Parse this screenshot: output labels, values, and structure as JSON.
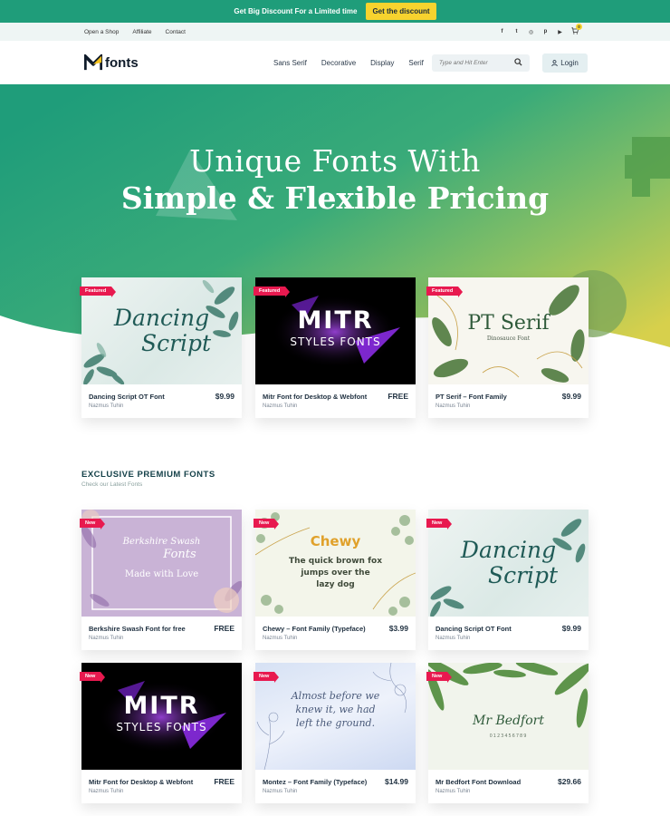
{
  "promo": {
    "text": "Get Big Discount For a Limited time",
    "button": "Get the discount"
  },
  "util": {
    "links": [
      "Open a Shop",
      "Affiliate",
      "Contact"
    ],
    "social": [
      "f",
      "t",
      "◎",
      "p",
      "▶"
    ],
    "cart_count": "0"
  },
  "nav": {
    "logo": "fonts",
    "menu": [
      "Sans Serif",
      "Decorative",
      "Display",
      "Serif"
    ],
    "search_placeholder": "Type and Hit Enter",
    "login": "Login"
  },
  "hero": {
    "line1": "Unique Fonts With",
    "line2": "Simple & Flexible Pricing"
  },
  "featured": [
    {
      "badge": "Featured",
      "name": "Dancing Script OT Font",
      "author": "Nazmus Tuhin",
      "price": "$9.99",
      "art": [
        "Dancing",
        "Script"
      ]
    },
    {
      "badge": "Featured",
      "name": "Mitr Font for Desktop & Webfont",
      "author": "Nazmus Tuhin",
      "price": "FREE",
      "art": [
        "MITR",
        "STYLES FONTS"
      ]
    },
    {
      "badge": "Featured",
      "name": "PT Serif – Font Family",
      "author": "Nazmus Tuhin",
      "price": "$9.99",
      "art": [
        "PT Serif",
        "Dinosauce Font"
      ]
    }
  ],
  "section": {
    "title": "EXCLUSIVE PREMIUM FONTS",
    "subtitle": "Check our Latest Fonts"
  },
  "latest": [
    {
      "badge": "New",
      "name": "Berkshire Swash Font for free",
      "author": "Nazmus Tuhin",
      "price": "FREE",
      "art": [
        "Berkshire Swash",
        "Fonts",
        "Made with Love"
      ]
    },
    {
      "badge": "New",
      "name": "Chewy – Font Family (Typeface)",
      "author": "Nazmus Tuhin",
      "price": "$3.99",
      "art": [
        "Chewy",
        "The quick brown fox",
        "jumps over the",
        "lazy dog"
      ]
    },
    {
      "badge": "New",
      "name": "Dancing Script OT Font",
      "author": "Nazmus Tuhin",
      "price": "$9.99",
      "art": [
        "Dancing",
        "Script"
      ]
    },
    {
      "badge": "New",
      "name": "Mitr Font for Desktop & Webfont",
      "author": "Nazmus Tuhin",
      "price": "FREE",
      "art": [
        "MITR",
        "STYLES FONTS"
      ]
    },
    {
      "badge": "New",
      "name": "Montez – Font Family (Typeface)",
      "author": "Nazmus Tuhin",
      "price": "$14.99",
      "art": [
        "Almost before we",
        "knew it, we had",
        "left the ground."
      ]
    },
    {
      "badge": "New",
      "name": "Mr Bedfort Font Download",
      "author": "Nazmus Tuhin",
      "price": "$29.66",
      "art": [
        "Mr Bedfort",
        "0123456789"
      ]
    }
  ]
}
